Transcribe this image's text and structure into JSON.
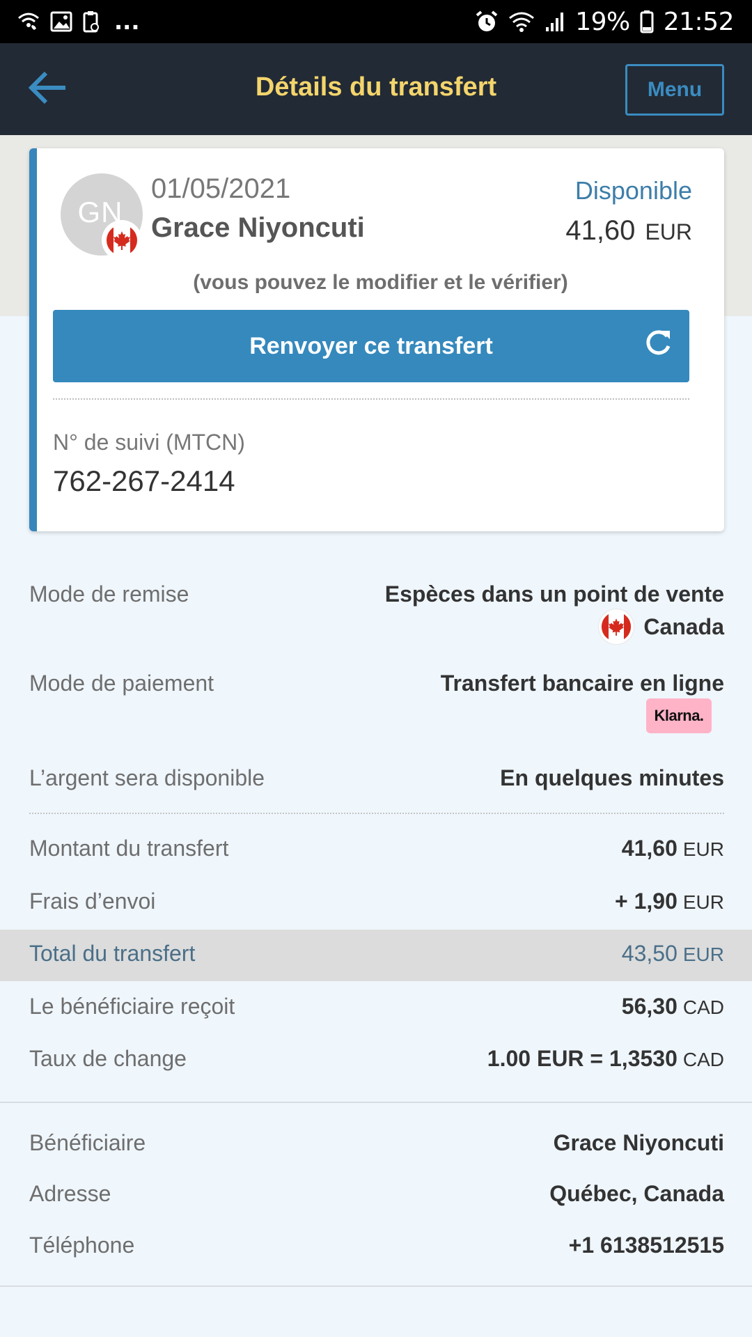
{
  "status_bar": {
    "left_icons": [
      "wifi-calling-icon",
      "image-icon",
      "clipboard-icon"
    ],
    "more": "...",
    "right_icons": [
      "alarm-icon",
      "wifi-icon",
      "signal-icon"
    ],
    "battery_percent": "19%",
    "time": "21:52"
  },
  "header": {
    "title": "Détails du transfert",
    "menu_label": "Menu",
    "accent_color": "#f4d56c",
    "button_color": "#3a8cc1"
  },
  "transfer_card": {
    "avatar_initials": "GN",
    "date": "01/05/2021",
    "name": "Grace Niyoncuti",
    "status": "Disponible",
    "amount": "41,60",
    "currency": "EUR",
    "note": "(vous pouvez le modifier et le vérifier)",
    "resend_label": "Renvoyer ce transfert",
    "mtcn_label": "N° de suivi (MTCN)",
    "mtcn_value": "762-267-2414",
    "flag_icon": "canada-flag-icon"
  },
  "details": {
    "delivery_mode_label": "Mode de remise",
    "delivery_mode_value": "Espèces dans un point de vente",
    "delivery_country": "Canada",
    "payment_mode_label": "Mode de paiement",
    "payment_mode_value": "Transfert bancaire en ligne",
    "payment_provider": "Klarna.",
    "availability_label": "L’argent sera disponible",
    "availability_value": "En quelques minutes"
  },
  "amounts": {
    "transfer_amount_label": "Montant du transfert",
    "transfer_amount_value": "41,60",
    "transfer_amount_currency": "EUR",
    "fees_label": "Frais d’envoi",
    "fees_value": "+ 1,90",
    "fees_currency": "EUR",
    "total_label": "Total du transfert",
    "total_value": "43,50",
    "total_currency": "EUR",
    "received_label": "Le bénéficiaire reçoit",
    "received_value": "56,30",
    "received_currency": "CAD",
    "rate_label": "Taux de change",
    "rate_value": "1.00 EUR = 1,3530",
    "rate_currency": "CAD"
  },
  "beneficiary": {
    "beneficiary_label": "Bénéficiaire",
    "beneficiary_value": "Grace Niyoncuti",
    "address_label": "Adresse",
    "address_value": "Québec, Canada",
    "phone_label": "Téléphone",
    "phone_value": "+1 6138512515"
  }
}
